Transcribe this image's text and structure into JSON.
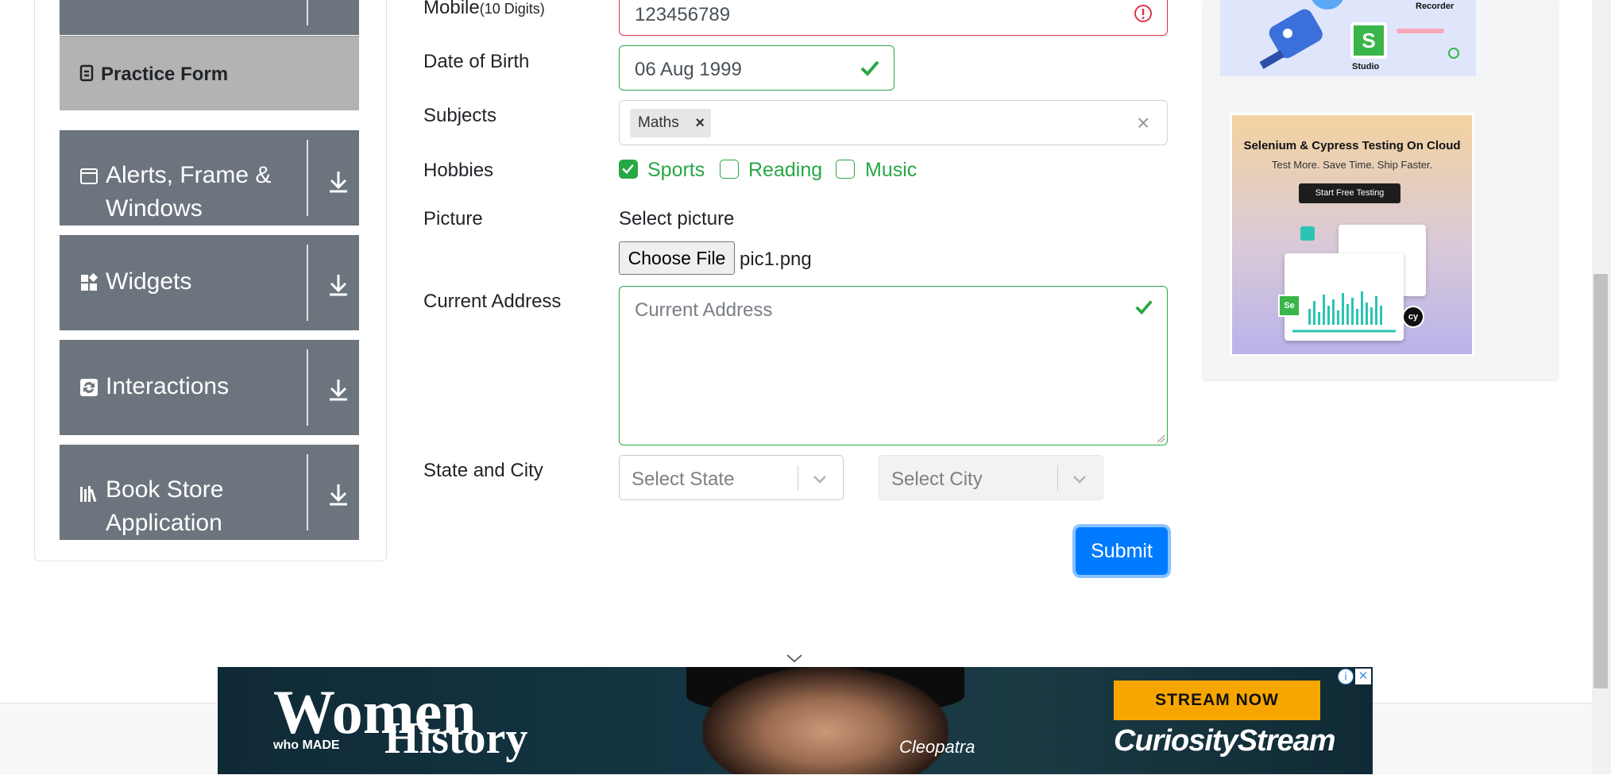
{
  "sidebar": {
    "practice_form": "Practice Form",
    "groups": [
      {
        "label": "Alerts, Frame & Windows"
      },
      {
        "label": "Widgets"
      },
      {
        "label": "Interactions"
      },
      {
        "label": "Book Store Application"
      }
    ]
  },
  "form": {
    "mobile": {
      "label": "Mobile",
      "hint": "(10 Digits)",
      "value": "123456789",
      "state": "invalid"
    },
    "dob": {
      "label": "Date of Birth",
      "value": "06 Aug 1999"
    },
    "subjects": {
      "label": "Subjects",
      "tags": [
        "Maths"
      ],
      "tag_remove": "×",
      "clear": "×"
    },
    "hobbies": {
      "label": "Hobbies",
      "options": [
        {
          "label": "Sports",
          "checked": true
        },
        {
          "label": "Reading",
          "checked": false
        },
        {
          "label": "Music",
          "checked": false
        }
      ]
    },
    "picture": {
      "label": "Picture",
      "select_label": "Select picture",
      "button": "Choose File",
      "filename": "pic1.png"
    },
    "address": {
      "label": "Current Address",
      "placeholder": "Current Address"
    },
    "state_city": {
      "label": "State and City",
      "state_placeholder": "Select State",
      "city_placeholder": "Select City"
    },
    "submit": "Submit"
  },
  "ads": {
    "top_ad": {
      "recorder": "Recorder",
      "studio": "Studio"
    },
    "cloud_ad": {
      "title": "Selenium & Cypress Testing On Cloud",
      "subtitle": "Test More. Save Time. Ship Faster.",
      "cta": "Start Free Testing"
    },
    "bottom_ad": {
      "title_main": "Women",
      "title_small": "who MADE",
      "title_end": "History",
      "name": "Cleopatra",
      "stream_btn": "STREAM NOW",
      "brand": "CuriosityStream",
      "info": "i",
      "close": "✕"
    }
  },
  "colors": {
    "sidebar_group": "#6c757d",
    "practice_active": "#b3b3b3",
    "invalid": "#dc3545",
    "valid": "#28a745",
    "primary": "#007bff"
  }
}
